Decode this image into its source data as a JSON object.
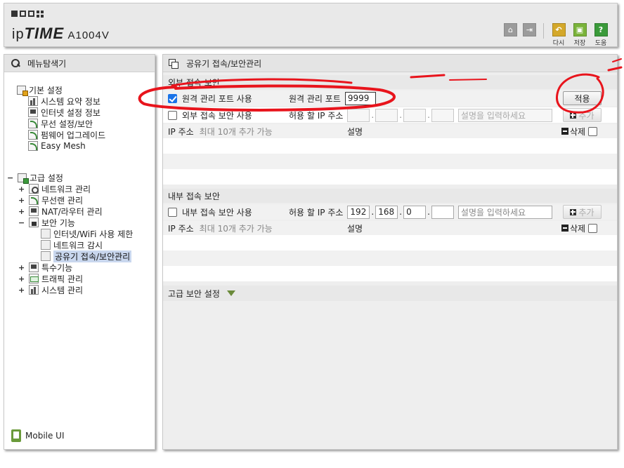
{
  "header": {
    "brand_ip": "ip",
    "brand_time": "TIME",
    "model": "A1004V",
    "buttons": [
      {
        "label": "다시",
        "icon": "undo-icon",
        "color": "#d4a82a"
      },
      {
        "label": "저장",
        "icon": "save-icon",
        "color": "#7ab33a"
      },
      {
        "label": "도움",
        "icon": "help-icon",
        "color": "#3a9a3a"
      }
    ],
    "help_glyph": "?"
  },
  "sidebar": {
    "title": "메뉴탐색기",
    "groups": [
      {
        "label": "기본 설정",
        "items": [
          "시스템 요약 정보",
          "인터넷 설정 정보",
          "무선 설정/보안",
          "펌웨어 업그레이드",
          "Easy Mesh"
        ]
      },
      {
        "label": "고급 설정",
        "expander": "−",
        "items": [
          {
            "label": "네트워크 관리",
            "expander": "+"
          },
          {
            "label": "무선랜 관리",
            "expander": "+"
          },
          {
            "label": "NAT/라우터 관리",
            "expander": "+"
          },
          {
            "label": "보안 기능",
            "expander": "−",
            "children": [
              "인터넷/WiFi 사용 제한",
              "네트워크 감시",
              "공유기 접속/보안관리"
            ]
          },
          {
            "label": "특수기능",
            "expander": "+"
          },
          {
            "label": "트래픽 관리",
            "expander": "+"
          },
          {
            "label": "시스템 관리",
            "expander": "+"
          }
        ]
      }
    ],
    "mobile_ui": "Mobile UI"
  },
  "main": {
    "title": "공유기 접속/보안관리",
    "external": {
      "section_title": "외부 접속 보안",
      "remote_port_checkbox_label": "원격 관리 포트 사용",
      "remote_port_checked": true,
      "remote_port_label": "원격 관리 포트",
      "remote_port_value": "9999",
      "apply_button": "적용",
      "access_checkbox_label": "외부 접속 보안 사용",
      "access_checked": false,
      "allowed_ip_label": "허용 할 IP 주소",
      "ip_fields": [
        "",
        "",
        "",
        ""
      ],
      "desc_placeholder": "설명을 입력하세요",
      "add_button": "추가",
      "table": {
        "col_ip": "IP 주소",
        "col_ip_hint": "최대 10개 추가 가능",
        "col_desc": "설명",
        "col_delete": "삭제"
      }
    },
    "internal": {
      "section_title": "내부 접속 보안",
      "access_checkbox_label": "내부 접속 보안 사용",
      "access_checked": false,
      "allowed_ip_label": "허용 할 IP 주소",
      "ip_fields": [
        "192",
        "168",
        "0",
        ""
      ],
      "desc_placeholder": "설명을 입력하세요",
      "add_button": "추가",
      "table": {
        "col_ip": "IP 주소",
        "col_ip_hint": "최대 10개 추가 가능",
        "col_desc": "설명",
        "col_delete": "삭제"
      }
    },
    "advanced": {
      "section_title": "고급 보안 설정"
    }
  },
  "annotation_color": "#e8141c"
}
